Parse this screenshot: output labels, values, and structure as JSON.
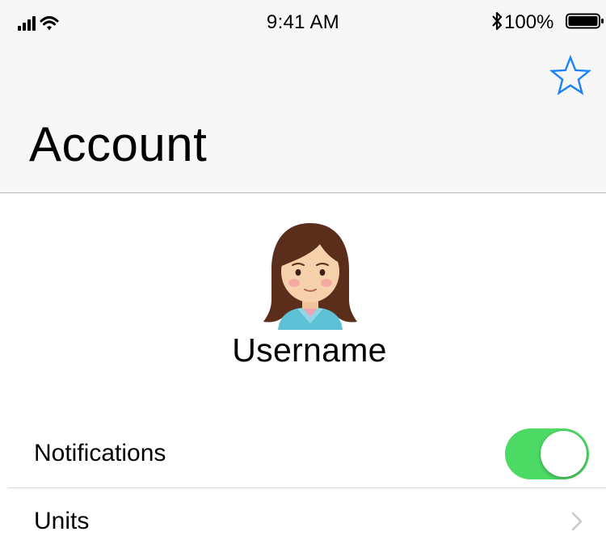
{
  "status_bar": {
    "time": "9:41 AM",
    "battery_percent": "100%",
    "battery_level": 1.0,
    "signal_icon": "cellular-signal-icon",
    "wifi_icon": "wifi-icon",
    "bluetooth_icon": "bluetooth-icon",
    "battery_icon": "battery-icon"
  },
  "nav": {
    "title": "Account",
    "favorite_icon": "star-outline-icon"
  },
  "profile": {
    "avatar_icon": "woman-emoji-avatar",
    "username": "Username"
  },
  "settings": {
    "notifications": {
      "label": "Notifications",
      "enabled": true
    },
    "units": {
      "label": "Units",
      "accessory_icon": "chevron-right-icon"
    }
  },
  "colors": {
    "accent": "#1a82fb",
    "toggle_on": "#4cd964",
    "nav_background": "#f7f7f7",
    "chevron": "#c7c7cc"
  }
}
